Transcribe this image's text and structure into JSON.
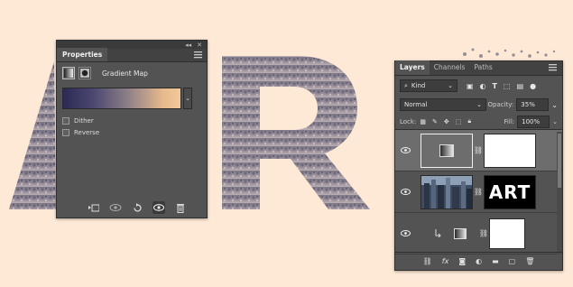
{
  "properties": {
    "tab_label": "Properties",
    "header_title": "Gradient Map",
    "gradient": {
      "colors": [
        "#2c2a55",
        "#4a4670",
        "#8d7f88",
        "#e6b98c",
        "#f3c99a"
      ]
    },
    "dither_label": "Dither",
    "reverse_label": "Reverse"
  },
  "layers": {
    "tabs": [
      "Layers",
      "Channels",
      "Paths"
    ],
    "filter_kind": "Kind",
    "blend_mode": "Normal",
    "opacity_label": "Opacity:",
    "opacity_value": "35%",
    "lock_label": "Lock:",
    "fill_label": "Fill:",
    "fill_value": "100%",
    "text_layer_content": "ART"
  },
  "colors": {
    "background": "#fde9d6",
    "panel": "#535353",
    "selected_layer": "#6d6d6d"
  }
}
